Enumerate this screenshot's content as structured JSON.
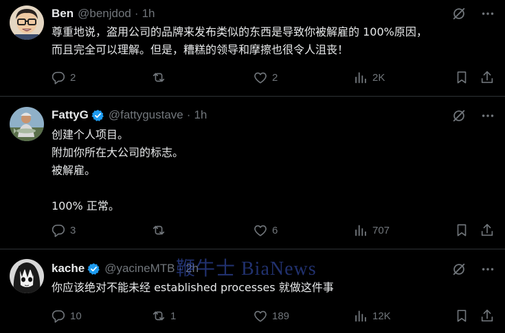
{
  "tweets": [
    {
      "name": "Ben",
      "handle": "@benjdod",
      "separator": "·",
      "time": "1h",
      "verified": false,
      "body": "尊重地说，盗用公司的品牌来发布类似的东西是导致你被解雇的 100%原因，\n而且完全可以理解。但是，糟糕的领导和摩擦也很令人沮丧！",
      "replies": "2",
      "retweets": "",
      "likes": "2",
      "views": "2K"
    },
    {
      "name": "FattyG",
      "handle": "@fattygustave",
      "separator": "·",
      "time": "1h",
      "verified": true,
      "body": "创建个人项目。\n附加你所在大公司的标志。\n被解雇。\n\n100% 正常。",
      "replies": "3",
      "retweets": "",
      "likes": "6",
      "views": "707"
    },
    {
      "name": "kache",
      "handle": "@yacineMTB",
      "separator": "·",
      "time": "2h",
      "verified": true,
      "body": "你应该绝对不能未经 established processes 就做这件事",
      "replies": "10",
      "retweets": "1",
      "likes": "189",
      "views": "12K"
    }
  ],
  "watermark": "鞭牛士 BiaNews",
  "colors": {
    "background": "#000000",
    "text": "#e7e9ea",
    "muted": "#71767b",
    "divider": "#2f3336",
    "verified": "#1d9bf0"
  }
}
